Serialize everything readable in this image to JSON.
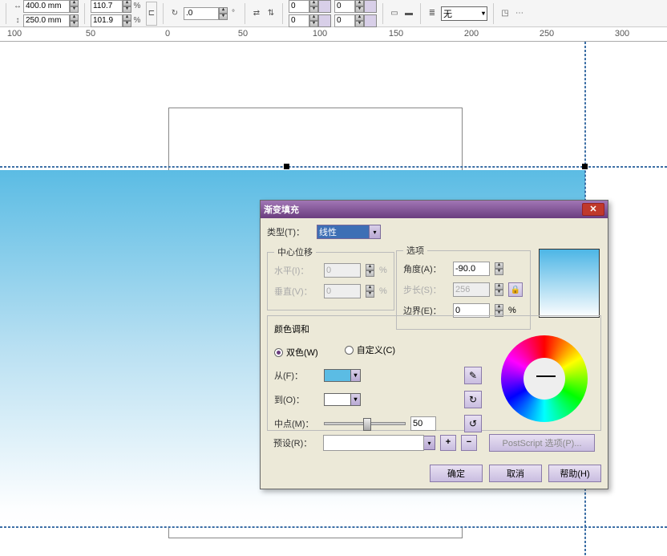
{
  "toolbar": {
    "width": "400.0 mm",
    "height": "250.0 mm",
    "scale_x": "110.7",
    "scale_y": "101.9",
    "rotation": ".0",
    "offset_a": "0",
    "offset_b": "0",
    "offset_c": "0",
    "offset_d": "0",
    "wrap_label": "无"
  },
  "ruler": {
    "marks": [
      "100",
      "50",
      "0",
      "50",
      "100",
      "150",
      "200",
      "250",
      "300"
    ]
  },
  "dialog": {
    "title": "渐变填充",
    "type_label": "类型(T)：",
    "type_value": "线性",
    "center_group": "中心位移",
    "horiz_label": "水平(I)：",
    "horiz_val": "0",
    "vert_label": "垂直(V)：",
    "vert_val": "0",
    "options_group": "选项",
    "angle_label": "角度(A)：",
    "angle_val": "-90.0",
    "step_label": "步长(S)：",
    "step_val": "256",
    "edge_label": "边界(E)：",
    "edge_val": "0",
    "pct": "%",
    "color_group": "颜色调和",
    "two_color": "双色(W)",
    "custom": "自定义(C)",
    "from_label": "从(F)：",
    "to_label": "到(O)：",
    "mid_label": "中点(M)：",
    "mid_val": "50",
    "preset_label": "预设(R)：",
    "ps_btn": "PostScript 选项(P)...",
    "ok": "确定",
    "cancel": "取消",
    "help": "帮助(H)"
  }
}
